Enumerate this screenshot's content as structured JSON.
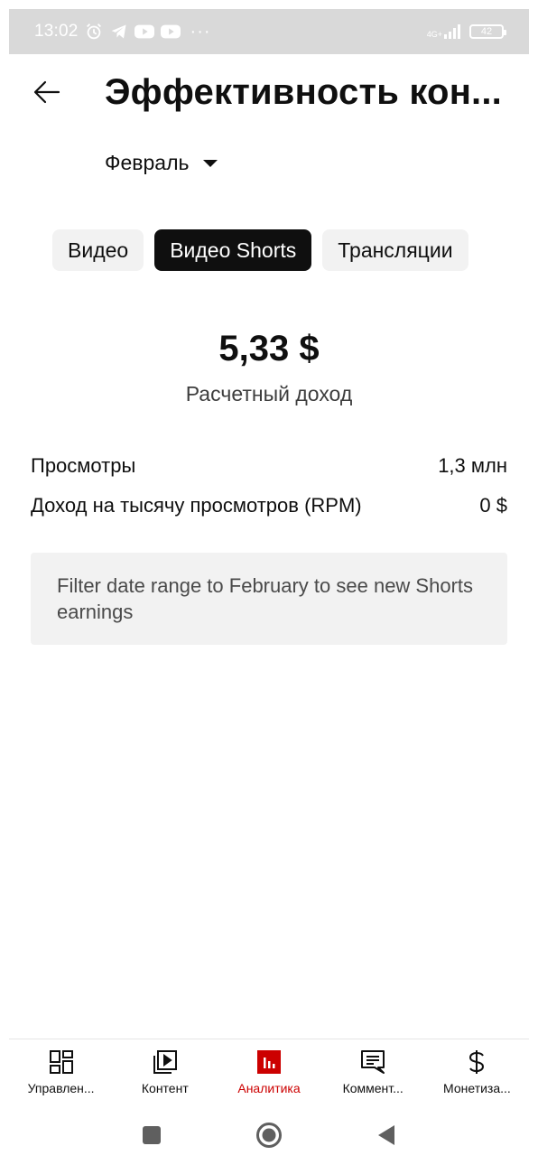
{
  "status_bar": {
    "time": "13:02",
    "network": "4G+",
    "battery": "42",
    "more": "···"
  },
  "header": {
    "title": "Эффективность кон...",
    "month": "Февраль"
  },
  "tabs": [
    {
      "label": "Видео",
      "active": false
    },
    {
      "label": "Видео Shorts",
      "active": true
    },
    {
      "label": "Трансляции",
      "active": false
    }
  ],
  "metric": {
    "value": "5,33 $",
    "label": "Расчетный доход"
  },
  "stats": [
    {
      "label": "Просмотры",
      "value": "1,3 млн"
    },
    {
      "label": "Доход на тысячу просмотров (RPM)",
      "value": "0 $"
    }
  ],
  "notice": "Filter date range to February to see new Shorts earnings",
  "bottom_nav": [
    {
      "label": "Управлен...",
      "icon": "dashboard-icon",
      "active": false
    },
    {
      "label": "Контент",
      "icon": "content-icon",
      "active": false
    },
    {
      "label": "Аналитика",
      "icon": "analytics-icon",
      "active": true
    },
    {
      "label": "Коммент...",
      "icon": "comments-icon",
      "active": false
    },
    {
      "label": "Монетиза...",
      "icon": "dollar-icon",
      "active": false
    }
  ],
  "colors": {
    "accent": "#cc0000",
    "active_chip": "#0f0f0f",
    "chip": "#f2f2f2"
  }
}
